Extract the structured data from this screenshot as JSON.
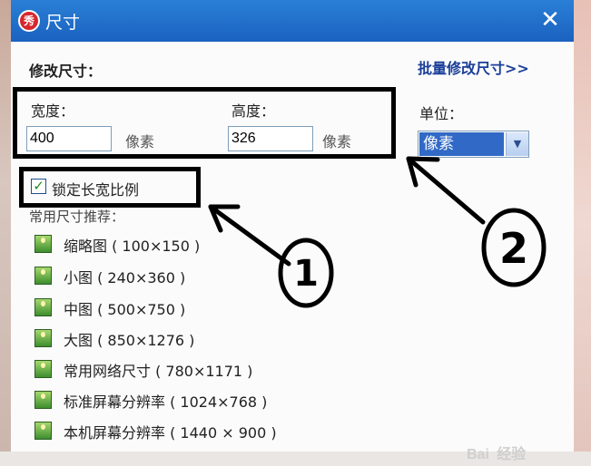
{
  "window": {
    "title": "尺寸",
    "close_glyph": "✕",
    "app_icon_glyph": "秀"
  },
  "resize": {
    "heading": "修改尺寸：",
    "batch_link": "批量修改尺寸>>",
    "width_label": "宽度：",
    "width_value": "400",
    "width_unit": "像素",
    "height_label": "高度：",
    "height_value": "326",
    "height_unit": "像素",
    "unit_label": "单位：",
    "unit_selected": "像素",
    "lock_ratio_label": "锁定长宽比例",
    "lock_ratio_checked": true,
    "presets_label": "常用尺寸推荐："
  },
  "presets": [
    {
      "label": "缩略图 ( 100×150 )"
    },
    {
      "label": "小图 ( 240×360 )"
    },
    {
      "label": "中图 ( 500×750 )"
    },
    {
      "label": "大图 ( 850×1276 )"
    },
    {
      "label": "常用网络尺寸 ( 780×1171 )"
    },
    {
      "label": "标准屏幕分辨率 ( 1024×768 )"
    },
    {
      "label": "本机屏幕分辨率 ( 1440 × 900 )"
    }
  ],
  "annotations": {
    "marker_1": "1",
    "marker_2": "2",
    "color": "#000000"
  },
  "watermark": {
    "brand": "Bai",
    "text": "经验"
  },
  "colors": {
    "titlebar": "#1f6fcc",
    "selection": "#3169c6",
    "link": "#1b3f9a"
  }
}
